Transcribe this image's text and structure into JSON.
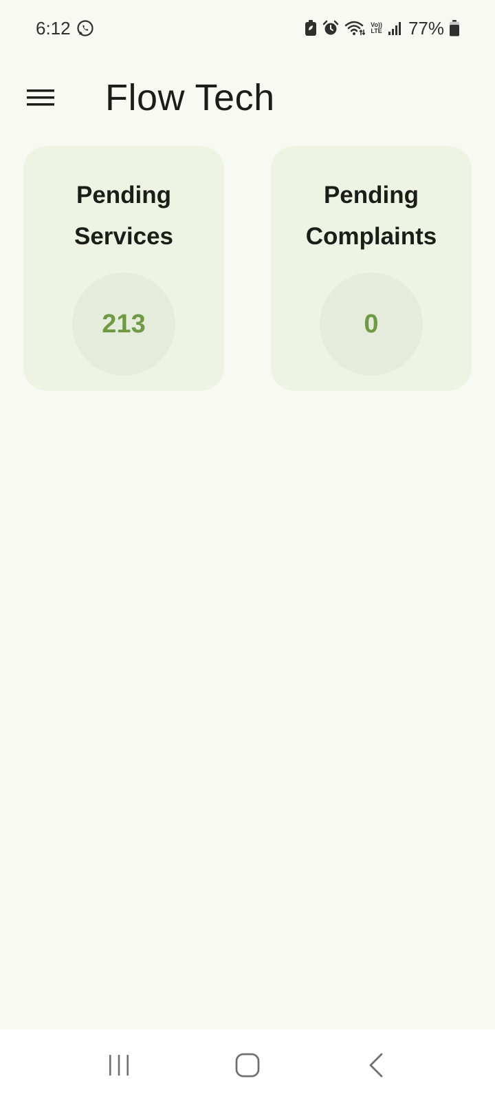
{
  "status_bar": {
    "time": "6:12",
    "battery_percent": "77%",
    "volte_top": "Vo))",
    "volte_bottom": "LTE",
    "icons": [
      "whatsapp-icon",
      "battery-saver-icon",
      "alarm-icon",
      "wifi-icon",
      "volte-icon",
      "signal-icon",
      "battery-icon"
    ]
  },
  "app_bar": {
    "title": "Flow Tech",
    "menu_icon": "hamburger-menu-icon"
  },
  "cards": [
    {
      "title": "Pending\nServices",
      "count": "213"
    },
    {
      "title": "Pending\nComplaints",
      "count": "0"
    }
  ],
  "nav_bar": {
    "icons": [
      "recent-apps-icon",
      "home-icon",
      "back-icon"
    ]
  },
  "colors": {
    "background": "#f8f9f2",
    "card": "#eff3e3",
    "count_circle": "#e6ecdc",
    "accent": "#6f9a45",
    "text": "#1c1d18"
  }
}
